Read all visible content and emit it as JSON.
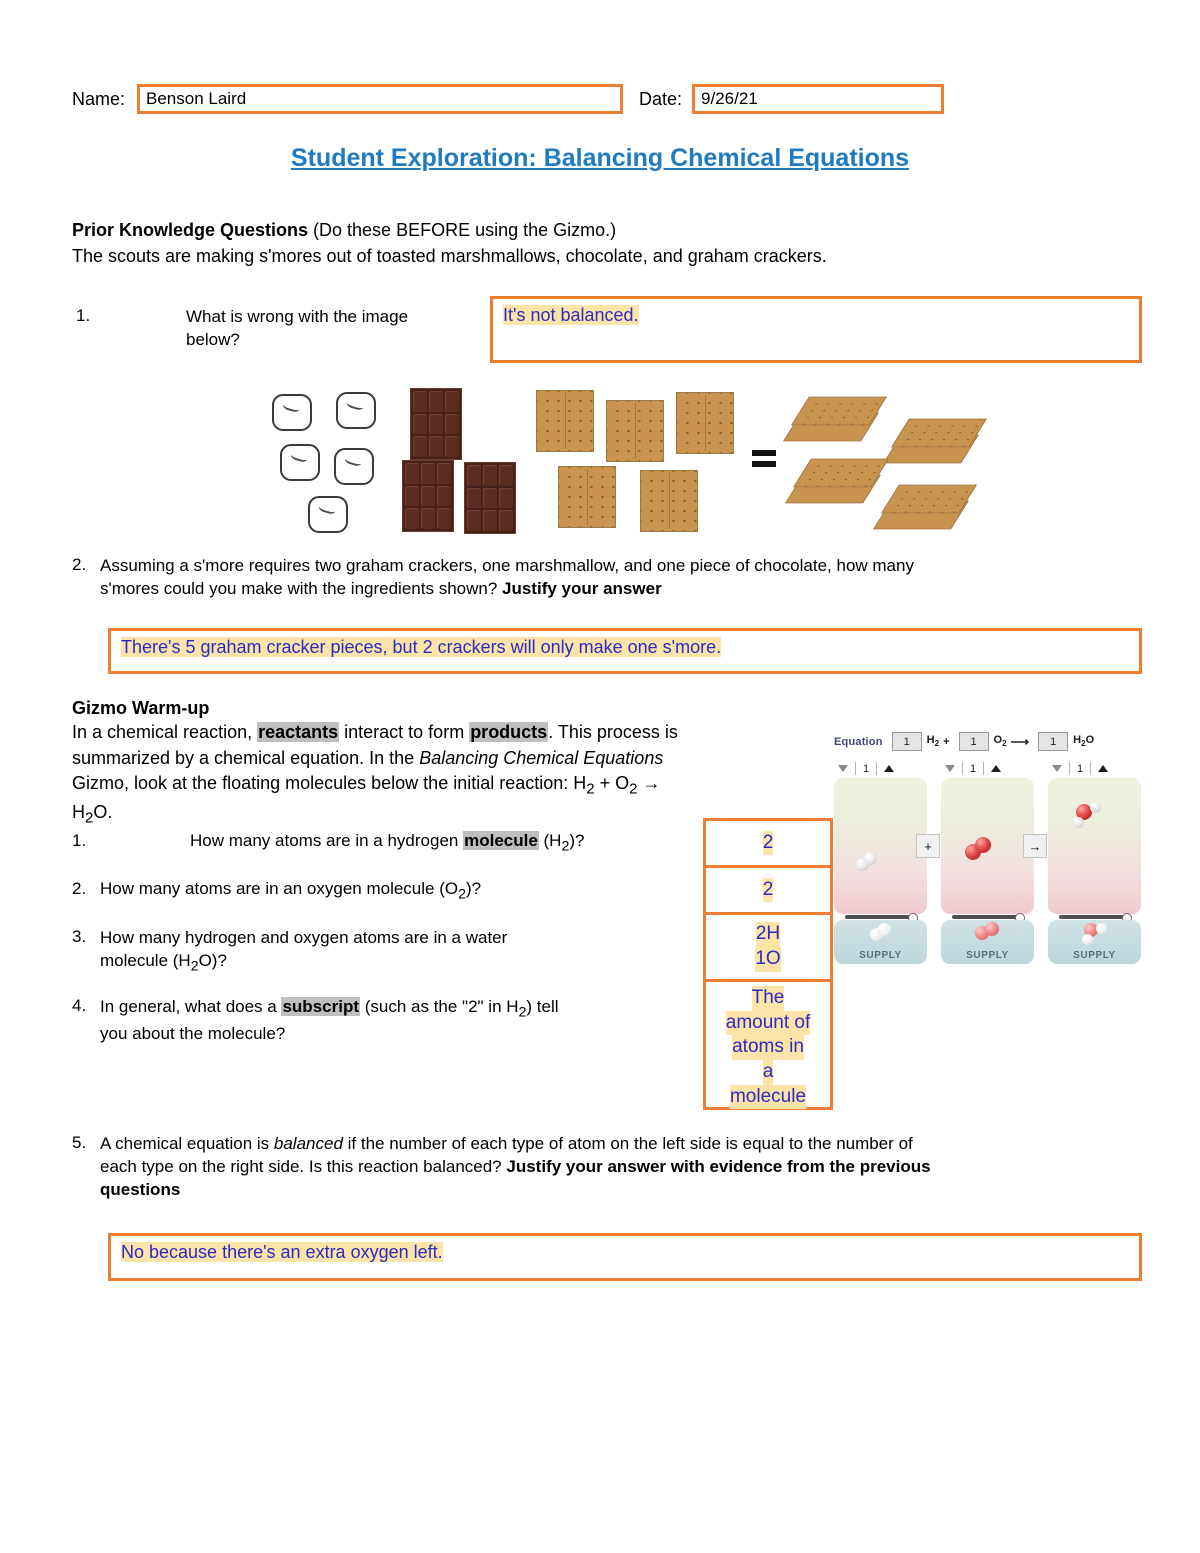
{
  "header": {
    "name_label": "Name:",
    "name_value": "Benson Laird",
    "date_label": "Date:",
    "date_value": "9/26/21"
  },
  "title": "Student Exploration: Balancing Chemical Equations",
  "prior_knowledge": {
    "heading": "Prior Knowledge Questions",
    "heading_rest": " (Do these BEFORE using the Gizmo.)",
    "intro": "The scouts are making s'mores out of toasted marshmallows, chocolate, and graham crackers.",
    "q1_num": "1.",
    "q1_text_line1": "What is wrong with the image",
    "q1_text_line2": "below?",
    "q1_answer": "It's not balanced.",
    "q2_num": "2.",
    "q2_text_a": "Assuming a s'more requires two graham crackers, one marshmallow, and one piece of chocolate, how many",
    "q2_text_b": "s'mores could you make with the ingredients shown? ",
    "q2_text_bold": "Justify your answer",
    "q2_answer": "There's 5 graham cracker pieces, but 2 crackers will only make one s'more."
  },
  "illustration": {
    "marshmallow_count": 5,
    "chocolate_count": 3,
    "cracker_count": 5,
    "smore_count": 4,
    "equals_sign": "=",
    "colors": {
      "chocolate": "#46201A",
      "cracker": "#C8944F",
      "marshmallow_outline": "#3a3a3a"
    }
  },
  "gizmo_warmup": {
    "heading": "Gizmo Warm-up",
    "p_a": "In a chemical reaction, ",
    "p_reactants": "reactants",
    "p_b": " interact to form ",
    "p_products": "products",
    "p_c": ". This process is",
    "p_d": "summarized by a chemical equation. In the ",
    "p_italic": "Balancing Chemical Equations",
    "p_e": "Gizmo, look at the floating molecules below the initial reaction: H",
    "p_f": " + O",
    "p_g": " →",
    "p_h": "H",
    "p_i": "O."
  },
  "questions": [
    {
      "num": "1.",
      "text_a": "How many atoms are in a hydrogen ",
      "text_hl": "molecule",
      "text_b": " (H",
      "text_c": ")?",
      "answer": "2"
    },
    {
      "num": "2.",
      "text_a": "How many atoms are in an oxygen molecule (O",
      "text_c": ")?",
      "answer": "2"
    },
    {
      "num": "3.",
      "text_line1": "How many hydrogen and oxygen atoms are in a water",
      "text_line2_a": "molecule (H",
      "text_line2_b": "O)?",
      "answer_line1": "2H",
      "answer_line2": "1O"
    },
    {
      "num": "4.",
      "text_a": "In general, what does a ",
      "text_hl": "subscript",
      "text_b": " (such as the \"2\" in H",
      "text_c": ") tell",
      "text_line2": "you about the molecule?",
      "answer_lines": [
        "The",
        "amount of",
        "atoms in",
        "a",
        "molecule"
      ]
    }
  ],
  "question5": {
    "num": "5.",
    "text_a": "A chemical equation is ",
    "text_italic": "balanced",
    "text_b": " if the number of each type of atom on the left side is equal to the number of",
    "text_c": "each type on the right side. Is this reaction balanced? ",
    "text_bold": "Justify your answer with evidence from the previous",
    "text_bold2": "questions",
    "answer": "No because there's an extra oxygen left."
  },
  "gizmo": {
    "equation_label": "Equation",
    "coef1": "1",
    "formula1": "H",
    "formula1_sub": "2",
    "plus": "+",
    "coef2": "1",
    "formula2": "O",
    "formula2_sub": "2",
    "arrow": "⟶",
    "coef3": "1",
    "formula3_a": "H",
    "formula3_sub": "2",
    "formula3_b": "O",
    "spinner_values": [
      "1",
      "1",
      "1"
    ],
    "supply_label": "SUPPLY",
    "op_plus": "+",
    "op_arrow": "→",
    "colors": {
      "panel_top": "#eef3df",
      "panel_bottom": "#f1c9cf",
      "tray": "#cfe2e5",
      "hydrogen_atom": "#e3e3e3",
      "oxygen_atom": "#d63b3b"
    }
  },
  "styling": {
    "border_orange": "#ED7D31",
    "highlight_yellow": "#FCE3A8",
    "answer_blue": "#2A2AC6",
    "title_blue": "#1F7AC0",
    "term_highlight_gray": "#BFBFBF"
  }
}
